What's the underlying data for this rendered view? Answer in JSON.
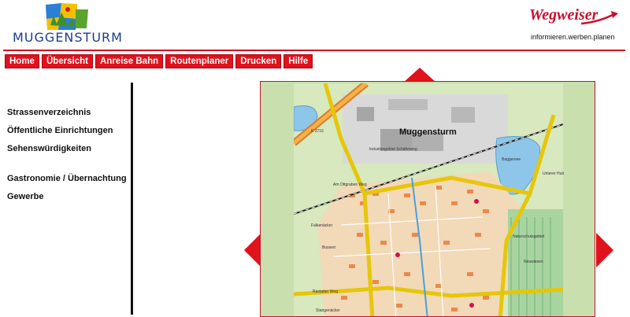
{
  "header": {
    "logo_left_text": "MUGGENSTURM",
    "logo_right_text": "Wegweiser",
    "logo_right_tagline": "informieren.werben.planen"
  },
  "nav": {
    "items": [
      {
        "label": "Home"
      },
      {
        "label": "Übersicht"
      },
      {
        "label": "Anreise Bahn"
      },
      {
        "label": "Routenplaner"
      },
      {
        "label": "Drucken"
      },
      {
        "label": "Hilfe"
      }
    ]
  },
  "sidebar": {
    "items": [
      {
        "label": "Strassenverzeichnis"
      },
      {
        "label": "Öffentliche Einrichtungen"
      },
      {
        "label": "Sehenswürdigkeiten"
      },
      {
        "label": "Gastronomie / Übernachtung"
      },
      {
        "label": "Gewerbe"
      }
    ]
  },
  "map": {
    "town_label": "Muggensturm",
    "labels": [
      "Industriegebiet Schäferweg",
      "Baggersee",
      "Am Ottgraben Weg",
      "Falkenäcker",
      "Bussert",
      "Rastatter Weg",
      "Stangenäcker",
      "Neuwiesen",
      "Naturschutzgebiet",
      "Unterer Hub",
      "K 3716"
    ]
  },
  "colors": {
    "accent": "#e0121c",
    "brand_blue": "#1c3d8f",
    "map_green": "#c9dfad",
    "map_water": "#8ec6ea"
  },
  "icons": [
    "arrow-up-icon",
    "arrow-left-icon",
    "arrow-right-icon",
    "muggensturm-emblem-icon",
    "wegweiser-swoosh-icon"
  ]
}
